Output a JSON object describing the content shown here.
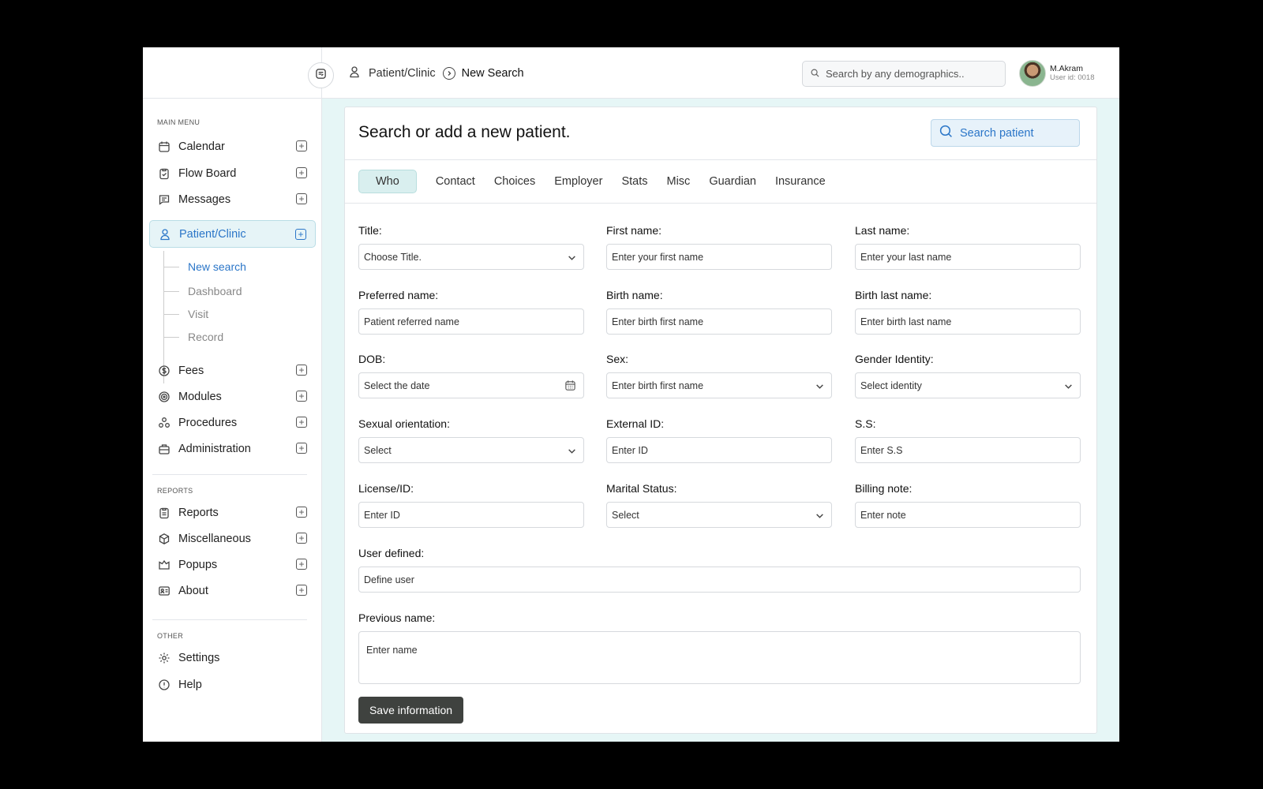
{
  "sidebar": {
    "main_menu_title": "MAIN MENU",
    "items": [
      {
        "label": "Calendar",
        "icon": "calendar-icon"
      },
      {
        "label": "Flow Board",
        "icon": "clipboard-icon"
      },
      {
        "label": "Messages",
        "icon": "message-icon"
      },
      {
        "label": "Patient/Clinic",
        "icon": "user-icon"
      },
      {
        "label": "Fees",
        "icon": "dollar-icon"
      },
      {
        "label": "Modules",
        "icon": "modules-icon"
      },
      {
        "label": "Procedures",
        "icon": "procedures-icon"
      },
      {
        "label": "Administration",
        "icon": "briefcase-icon"
      }
    ],
    "sub_items": [
      "New search",
      "Dashboard",
      "Visit",
      "Record"
    ],
    "reports_title": "REPORTS",
    "report_items": [
      {
        "label": "Reports",
        "icon": "report-icon"
      },
      {
        "label": "Miscellaneous",
        "icon": "box-icon"
      },
      {
        "label": "Popups",
        "icon": "popup-icon"
      },
      {
        "label": "About",
        "icon": "id-card-icon"
      }
    ],
    "other_title": "OTHER",
    "other_items": [
      {
        "label": "Settings",
        "icon": "gear-icon"
      },
      {
        "label": "Help",
        "icon": "help-icon"
      }
    ]
  },
  "header": {
    "breadcrumb_parent": "Patient/Clinic",
    "breadcrumb_current": "New Search",
    "search_placeholder": "Search by any demographics..",
    "user_name": "M.Akram",
    "user_id": "User id: 0018"
  },
  "main": {
    "title": "Search or add a new patient.",
    "search_patient_label": "Search patient",
    "tabs": [
      "Who",
      "Contact",
      "Choices",
      "Employer",
      "Stats",
      "Misc",
      "Guardian",
      "Insurance"
    ],
    "fields": {
      "title": {
        "label": "Title:",
        "value": "Choose Title."
      },
      "first_name": {
        "label": "First name:",
        "placeholder": "Enter your first name"
      },
      "last_name": {
        "label": "Last name:",
        "placeholder": "Enter your last name"
      },
      "preferred_name": {
        "label": "Preferred name:",
        "placeholder": "Patient referred name"
      },
      "birth_name": {
        "label": "Birth name:",
        "placeholder": "Enter birth first name"
      },
      "birth_last_name": {
        "label": "Birth last name:",
        "placeholder": "Enter birth last name"
      },
      "dob": {
        "label": "DOB:",
        "placeholder": "Select the date"
      },
      "sex": {
        "label": "Sex:",
        "value": "Enter birth first name"
      },
      "gender_identity": {
        "label": "Gender Identity:",
        "value": "Select identity"
      },
      "sexual_orientation": {
        "label": "Sexual orientation:",
        "value": "Select"
      },
      "external_id": {
        "label": "External ID:",
        "placeholder": "Enter ID"
      },
      "ss": {
        "label": "S.S:",
        "placeholder": "Enter S.S"
      },
      "license_id": {
        "label": "License/ID:",
        "placeholder": "Enter ID"
      },
      "marital_status": {
        "label": "Marital Status:",
        "value": "Select"
      },
      "billing_note": {
        "label": "Billing note:",
        "placeholder": "Enter note"
      },
      "user_defined": {
        "label": "User defined:",
        "placeholder": "Define user"
      },
      "previous_name": {
        "label": "Previous name:",
        "placeholder": "Enter name"
      }
    },
    "save_label": "Save information"
  },
  "colors": {
    "accent": "#2b76c8",
    "main_bg": "#e6f6f6",
    "save_button": "#3f423f"
  }
}
